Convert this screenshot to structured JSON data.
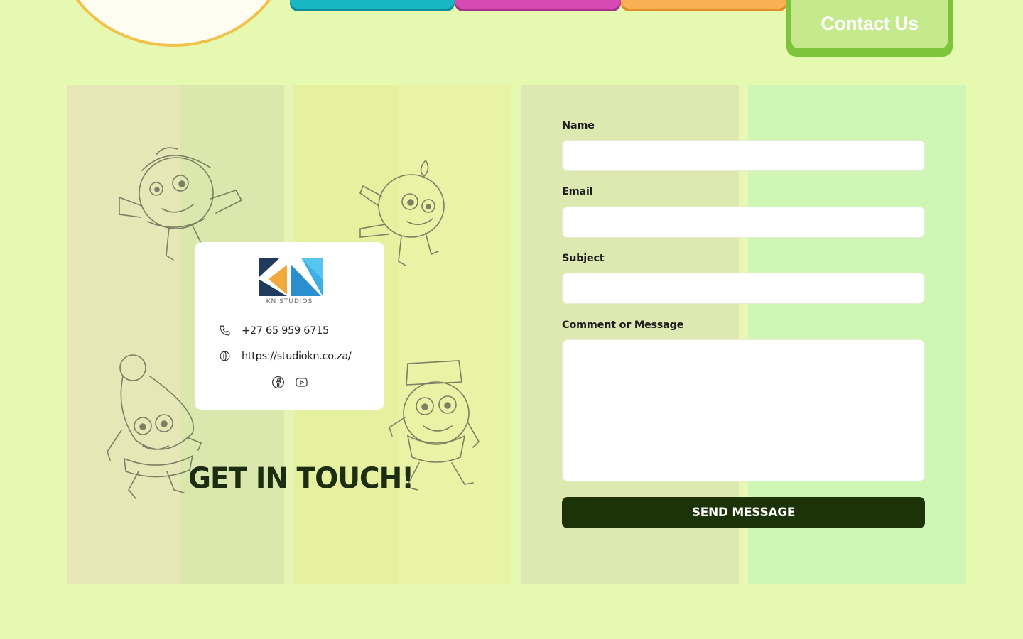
{
  "nav": {
    "contact_label": "Contact Us"
  },
  "contact_card": {
    "logo_caption": "KN STUDIOS",
    "phone": "+27 65 959 6715",
    "website": "https://studiokn.co.za/",
    "social_icons": [
      "facebook-icon",
      "youtube-icon"
    ]
  },
  "heading": "GET IN TOUCH!",
  "form": {
    "name_label": "Name",
    "email_label": "Email",
    "subject_label": "Subject",
    "message_label": "Comment or Message",
    "name_value": "",
    "email_value": "",
    "subject_value": "",
    "message_value": "",
    "send_label": "SEND MESSAGE"
  },
  "colors": {
    "page_bg": "#e5f9b0",
    "tab_teal": "#17b8c4",
    "tab_pink": "#d54bb3",
    "tab_orange": "#f8b053",
    "contact_green": "#7dc43b",
    "send_button": "#1b3306",
    "logo_navy": "#1e3a5c",
    "logo_orange": "#f2a93b",
    "logo_blue": "#3eaee6"
  }
}
